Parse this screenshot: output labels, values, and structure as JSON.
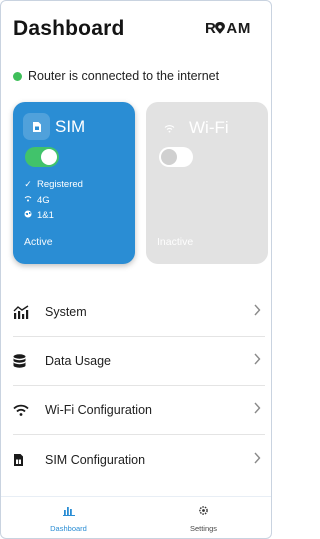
{
  "header": {
    "title": "Dashboard",
    "logo_text": "ROAM"
  },
  "status": {
    "text": "Router is connected to the internet",
    "color": "#3fbf5a"
  },
  "cards": {
    "sim": {
      "name": "SIM",
      "icon": "sim-card-icon",
      "toggle_on": true,
      "details": [
        {
          "icon": "check-icon",
          "text": "Registered"
        },
        {
          "icon": "signal-icon",
          "text": "4G"
        },
        {
          "icon": "globe-icon",
          "text": "1&1"
        }
      ],
      "state": "Active",
      "color": "#2a8dd4"
    },
    "wifi": {
      "name": "Wi-Fi",
      "icon": "wifi-icon",
      "toggle_on": false,
      "state": "Inactive",
      "color": "#e2e2e2"
    }
  },
  "menu": [
    {
      "icon": "system-chart-icon",
      "label": "System"
    },
    {
      "icon": "database-icon",
      "label": "Data Usage"
    },
    {
      "icon": "wifi-icon",
      "label": "Wi-Fi Configuration"
    },
    {
      "icon": "sim-card-icon",
      "label": "SIM Configuration"
    }
  ],
  "nav": [
    {
      "icon": "bar-chart-icon",
      "label": "Dashboard",
      "active": true
    },
    {
      "icon": "gear-icon",
      "label": "Settings",
      "active": false
    }
  ],
  "accent": "#2a8dd4"
}
